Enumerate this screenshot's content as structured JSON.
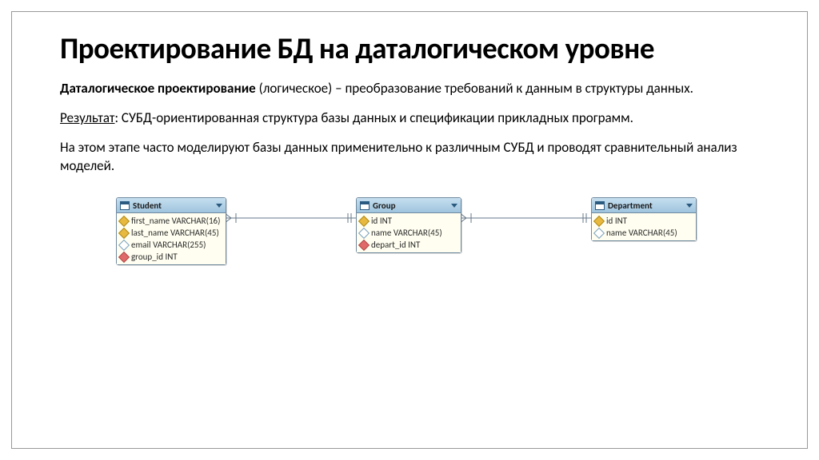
{
  "title": "Проектирование БД на даталогическом уровне",
  "p1_bold": "Даталогическое проектирование",
  "p1_rest": " (логическое) – преобразование требований к данным в структуры данных.",
  "p2_ul": "Результат",
  "p2_rest": ": СУБД-ориентированная структура базы данных и спецификации прикладных программ.",
  "p3": "На этом этапе часто моделируют базы данных применительно к различным СУБД и проводят сравнительный анализ моделей.",
  "chart_data": {
    "type": "table",
    "entities": [
      {
        "name": "Student",
        "columns": [
          {
            "name": "first_name",
            "type": "VARCHAR(16)",
            "icon": "key"
          },
          {
            "name": "last_name",
            "type": "VARCHAR(45)",
            "icon": "key"
          },
          {
            "name": "email",
            "type": "VARCHAR(255)",
            "icon": "open"
          },
          {
            "name": "group_id",
            "type": "INT",
            "icon": "red"
          }
        ]
      },
      {
        "name": "Group",
        "columns": [
          {
            "name": "id",
            "type": "INT",
            "icon": "key"
          },
          {
            "name": "name",
            "type": "VARCHAR(45)",
            "icon": "open"
          },
          {
            "name": "depart_id",
            "type": "INT",
            "icon": "red"
          }
        ]
      },
      {
        "name": "Department",
        "columns": [
          {
            "name": "id",
            "type": "INT",
            "icon": "key"
          },
          {
            "name": "name",
            "type": "VARCHAR(45)",
            "icon": "open"
          }
        ]
      }
    ],
    "relations": [
      {
        "from": "Student.group_id",
        "to": "Group.id"
      },
      {
        "from": "Group.depart_id",
        "to": "Department.id"
      }
    ]
  }
}
